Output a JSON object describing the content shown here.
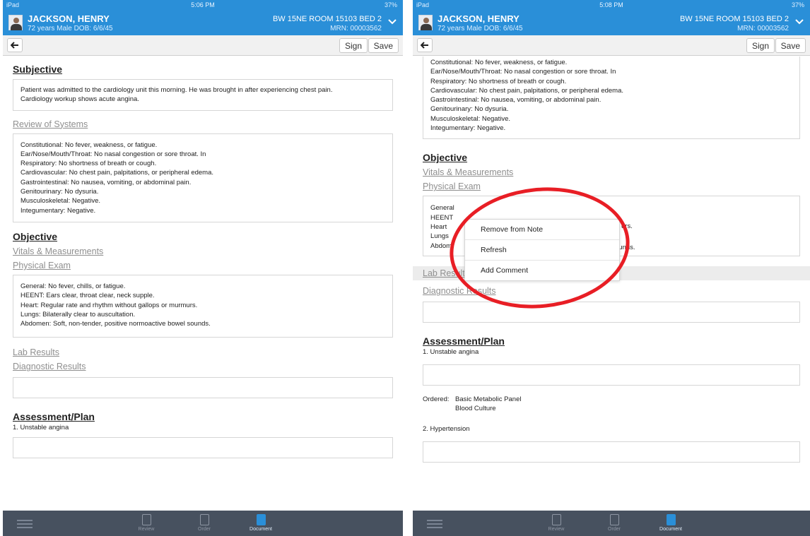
{
  "status_bar": {
    "left": {
      "carrier": "iPad"
    },
    "right": {
      "battery": "37%"
    },
    "left_time": "5:06 PM",
    "right_time": "5:08 PM"
  },
  "patient": {
    "name": "JACKSON, HENRY",
    "meta": "72 years  Male  DOB: 6/6/45",
    "room": "BW 15NE ROOM 15103 BED 2",
    "mrn": "MRN: 00003562"
  },
  "toolbar": {
    "sign_label": "Sign",
    "save_label": "Save"
  },
  "note": {
    "subjective_title": "Subjective",
    "subjective_text_1": "Patient was admitted to the cardiology unit this morning.  He was brought in after experiencing chest pain.",
    "subjective_text_2": "Cardiology workup shows acute angina.",
    "ros_link": "Review of Systems",
    "ros": [
      "Constitutional:  No fever, weakness, or fatigue.",
      "Ear/Nose/Mouth/Throat:  No nasal congestion or sore throat.  In",
      "Respiratory:  No shortness of breath or cough.",
      "Cardiovascular:  No chest pain, palpitations, or peripheral edema.",
      "Gastrointestinal:  No nausea, vomiting, or abdominal pain.",
      "Genitourinary:  No dysuria.",
      "Musculoskeletal:  Negative.",
      "Integumentary:  Negative."
    ],
    "objective_title": "Objective",
    "vitals_link": "Vitals & Measurements",
    "physical_link": "Physical Exam",
    "physical": [
      "General:  No fever, chills, or fatigue.",
      "HEENT:  Ears clear, throat clear, neck supple.",
      "Heart:  Regular rate and rhythm without gallops or murmurs.",
      "Lungs:  Bilaterally clear to auscultation.",
      "Abdomen:  Soft, non-tender, positive normoactive bowel sounds."
    ],
    "physical_partial": [
      {
        "left": "General",
        "right": ""
      },
      {
        "left": "HEENT",
        "right": ""
      },
      {
        "left": "Heart",
        "right": "urs."
      },
      {
        "left": "Lungs",
        "right": ""
      },
      {
        "left": "Abdom",
        "right": "ounds."
      }
    ],
    "lab_link": "Lab Results",
    "diag_link": "Diagnostic Results",
    "assessment_title": "Assessment/Plan",
    "problem_1": "1. Unstable angina",
    "ordered_label": "Ordered:",
    "ordered_1": "Basic Metabolic Panel",
    "ordered_2": "Blood Culture",
    "problem_2": "2. Hypertension"
  },
  "context_menu": {
    "items": [
      "Remove from Note",
      "Refresh",
      "Add Comment"
    ]
  },
  "bottom_tabs": {
    "review": "Review",
    "order": "Order",
    "document": "Document"
  },
  "colors": {
    "header_blue": "#2a8fd8",
    "bottom_bar": "#47515f",
    "annotation_red": "#e81e25"
  }
}
